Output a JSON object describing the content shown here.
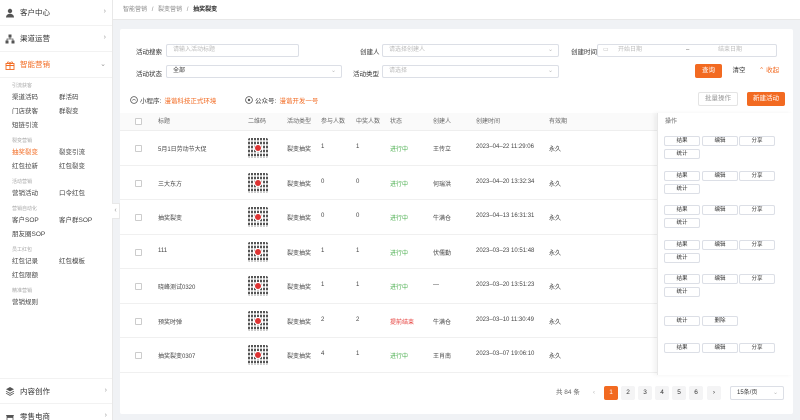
{
  "sidebar": {
    "sections": [
      {
        "label": "客户中心",
        "icon": "user-icon"
      },
      {
        "label": "渠道运营",
        "icon": "org-icon"
      },
      {
        "label": "智能营销",
        "icon": "gift-icon"
      }
    ],
    "groups": [
      {
        "title": "引流获客",
        "items": [
          "渠道活码",
          "群活码",
          "门店获客",
          "群裂变",
          "短链引流"
        ]
      },
      {
        "title": "裂变营销",
        "items": [
          "抽奖裂变",
          "裂变引流",
          "红包拉新",
          "红包裂变"
        ]
      },
      {
        "title": "活动营销",
        "items": [
          "营销活动",
          "口令红包"
        ]
      },
      {
        "title": "营销自动化",
        "items": [
          "客户SOP",
          "客户群SOP",
          "朋友圈SOP"
        ]
      },
      {
        "title": "员工红包",
        "items": [
          "红包记录",
          "红包模板",
          "红包限额"
        ]
      },
      {
        "title": "精准营销",
        "items": [
          "营销规则"
        ]
      }
    ],
    "bottom": [
      {
        "label": "内容创作",
        "icon": "content-icon"
      },
      {
        "label": "零售电商",
        "icon": "shop-icon"
      }
    ]
  },
  "breadcrumb": [
    "智能营销",
    "/",
    "裂变营销",
    "/",
    "抽奖裂变"
  ],
  "filters": {
    "activity_search_label": "活动搜索",
    "activity_search_placeholder": "请输入活动标题",
    "creator_label": "创建人",
    "creator_placeholder": "请选择创建人",
    "created_time_label": "创建时间",
    "start_date_placeholder": "开始日期",
    "range_sep": "–",
    "end_date_placeholder": "结束日期",
    "status_label": "活动状态",
    "status_value": "全部",
    "type_label": "活动类型",
    "type_placeholder": "请选择",
    "query_button": "查询",
    "clear_button": "清空",
    "collapse_button": "收起"
  },
  "info": {
    "miniprogram_label": "小程序:",
    "miniprogram_value": "漫谐科技正式环境",
    "official_label": "公众号:",
    "official_value": "漫谐开发一号",
    "batch_button": "批量操作",
    "new_button": "新建活动"
  },
  "table": {
    "headers": [
      "标题",
      "二维码",
      "活动类型",
      "参与人数",
      "中奖人数",
      "状态",
      "创建人",
      "创建时间",
      "有效期"
    ],
    "op_header": "操作",
    "rows": [
      {
        "title": "5月1日劳动节大促",
        "type": "裂变抽奖",
        "participants": "1",
        "winners": "1",
        "status": "进行中",
        "status_kind": "run",
        "creator": "王传立",
        "time": "2023–04–22 11:29:06",
        "validity": "永久",
        "ops": [
          "结果",
          "编辑",
          "分享",
          "统计"
        ]
      },
      {
        "title": "三大东方",
        "type": "裂变抽奖",
        "participants": "0",
        "winners": "0",
        "status": "进行中",
        "status_kind": "run",
        "creator": "何瑞洪",
        "time": "2023–04–20 13:32:34",
        "validity": "永久",
        "ops": [
          "结果",
          "编辑",
          "分享",
          "统计"
        ]
      },
      {
        "title": "抽奖裂变",
        "type": "裂变抽奖",
        "participants": "0",
        "winners": "0",
        "status": "进行中",
        "status_kind": "run",
        "creator": "牛满仓",
        "time": "2023–04–13 16:31:31",
        "validity": "永久",
        "ops": [
          "结果",
          "编辑",
          "分享",
          "统计"
        ]
      },
      {
        "title": "111",
        "type": "裂变抽奖",
        "participants": "1",
        "winners": "1",
        "status": "进行中",
        "status_kind": "run",
        "creator": "伏儒勤",
        "time": "2023–03–23 10:51:48",
        "validity": "永久",
        "ops": [
          "结果",
          "编辑",
          "分享",
          "统计"
        ]
      },
      {
        "title": "晓峰测试0320",
        "type": "裂变抽奖",
        "participants": "1",
        "winners": "1",
        "status": "进行中",
        "status_kind": "run",
        "creator": "—",
        "time": "2023–03–20 13:51:23",
        "validity": "永久",
        "ops": [
          "结果",
          "编辑",
          "分享",
          "统计"
        ]
      },
      {
        "title": "预奖时弹",
        "type": "裂变抽奖",
        "participants": "2",
        "winners": "2",
        "status": "提前结束",
        "status_kind": "end",
        "creator": "牛满仓",
        "time": "2023–03–10 11:30:49",
        "validity": "永久",
        "ops": [
          "统计",
          "删除"
        ]
      },
      {
        "title": "抽奖裂变0307",
        "type": "裂变抽奖",
        "participants": "4",
        "winners": "1",
        "status": "进行中",
        "status_kind": "run",
        "creator": "王肖南",
        "time": "2023–03–07 19:06:10",
        "validity": "永久",
        "ops": [
          "结果",
          "编辑",
          "分享"
        ]
      }
    ]
  },
  "pagination": {
    "total": "共 84 条",
    "prev": "‹",
    "pages": [
      "1",
      "2",
      "3",
      "4",
      "5",
      "6"
    ],
    "current": "1",
    "next": "›",
    "size": "15条/页"
  },
  "colors": {
    "accent": "#f26a21",
    "running": "#4caf50",
    "ended": "#e53935"
  }
}
